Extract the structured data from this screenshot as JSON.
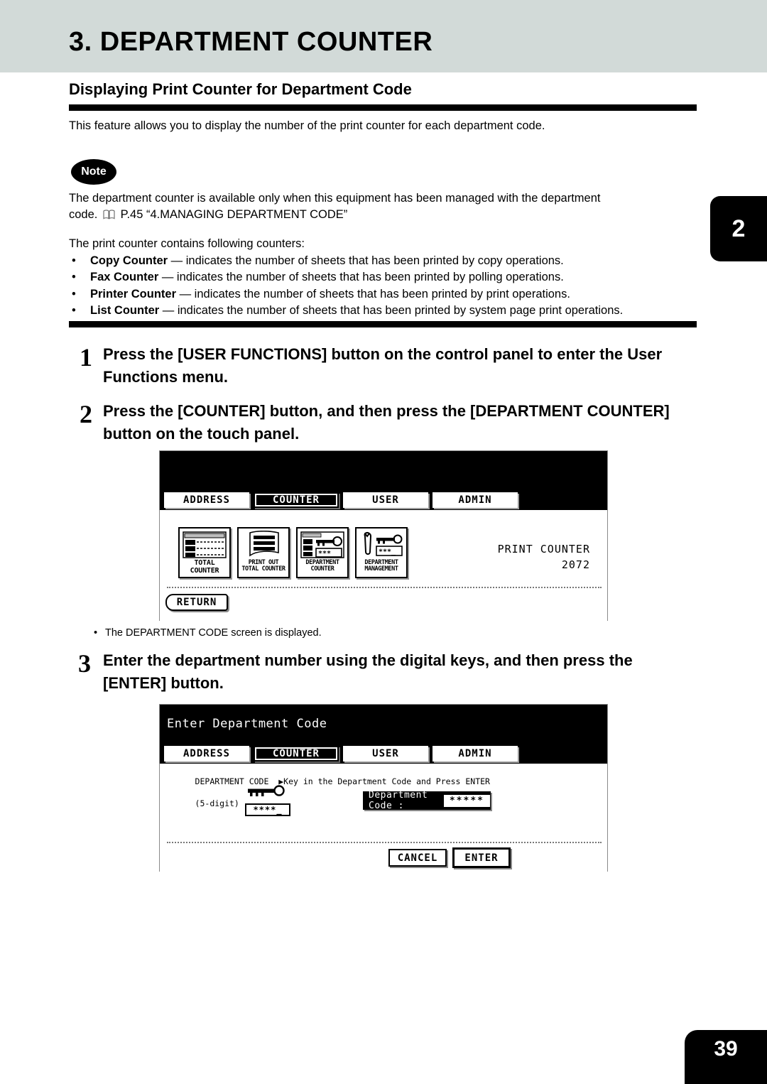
{
  "chapter": {
    "title": "3. DEPARTMENT COUNTER"
  },
  "section": {
    "heading": "Displaying Print Counter for Department Code"
  },
  "intro": "This feature allows you to display the number of the print counter for each department code.",
  "note": {
    "badge": "Note",
    "line1": "The department counter is available only when this equipment has been managed with the department",
    "line2_prefix": "code.",
    "line2_ref": "P.45 “4.MANAGING DEPARTMENT CODE”"
  },
  "counters": {
    "intro": "The print counter contains following counters:",
    "bullet": "•",
    "items": [
      {
        "name": "Copy Counter",
        "desc": " — indicates the number of sheets that has been printed by copy operations."
      },
      {
        "name": "Fax Counter",
        "desc": " — indicates the number of sheets that has been printed by polling operations."
      },
      {
        "name": "Printer Counter",
        "desc": " — indicates the number of sheets that has been printed by print operations."
      },
      {
        "name": "List Counter",
        "desc": " — indicates the number of sheets that has been printed by system page print operations."
      }
    ]
  },
  "steps": [
    {
      "num": "1",
      "text": "Press the [USER FUNCTIONS] button on the control panel to enter the User Functions menu."
    },
    {
      "num": "2",
      "text": "Press the [COUNTER] button, and then press the [DEPARTMENT COUNTER] button on the touch panel."
    },
    {
      "num": "3",
      "text": "Enter the department number using the digital keys, and then press the [ENTER] button."
    }
  ],
  "panel1": {
    "tabs": [
      {
        "label": "ADDRESS",
        "selected": false
      },
      {
        "label": "COUNTER",
        "selected": true
      },
      {
        "label": "USER",
        "selected": false
      },
      {
        "label": "ADMIN",
        "selected": false
      }
    ],
    "icon_buttons": [
      {
        "line1": "TOTAL",
        "line2": "COUNTER",
        "icon": "counter-list-icon"
      },
      {
        "line1": "PRINT OUT",
        "line2": "TOTAL COUNTER",
        "icon": "printout-icon"
      },
      {
        "line1": "DEPARTMENT",
        "line2": "COUNTER",
        "icon": "department-counter-icon"
      },
      {
        "line1": "DEPARTMENT",
        "line2": "MANAGEMENT",
        "icon": "department-management-icon"
      }
    ],
    "print_counter_label": "PRINT COUNTER",
    "print_counter_value": "2072",
    "return_label": "RETURN"
  },
  "caption": "The DEPARTMENT CODE screen is displayed.",
  "panel2": {
    "title": "Enter Department Code",
    "tabs": [
      {
        "label": "ADDRESS",
        "selected": false
      },
      {
        "label": "COUNTER",
        "selected": true
      },
      {
        "label": "USER",
        "selected": false
      },
      {
        "label": "ADMIN",
        "selected": false
      }
    ],
    "instruction_line1": "DEPARTMENT CODE  ▶Key in the Department Code and Press ENTER",
    "instruction_line2": "(5-digit)",
    "key_stars": "****_",
    "field_label": "Department Code :",
    "field_value": "*****",
    "cancel_label": "CANCEL",
    "enter_label": "ENTER"
  },
  "markers": {
    "side_tab": "2",
    "page_number": "39"
  },
  "colors": {
    "header_band": "#d2dad8",
    "ink": "#000000"
  }
}
